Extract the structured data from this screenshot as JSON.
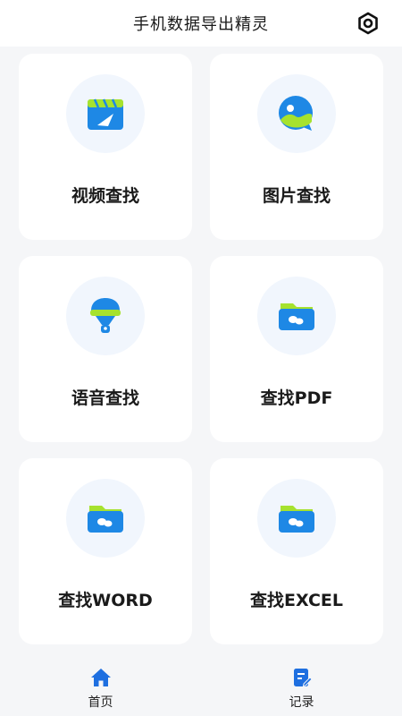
{
  "header": {
    "title": "手机数据导出精灵",
    "settings_icon": "settings-eye-icon"
  },
  "cards": [
    {
      "label": "视频查找",
      "icon": "video-icon"
    },
    {
      "label": "图片查找",
      "icon": "image-icon"
    },
    {
      "label": "语音查找",
      "icon": "voice-icon"
    },
    {
      "label": "查找PDF",
      "icon": "folder-icon"
    },
    {
      "label": "查找WORD",
      "icon": "folder-icon"
    },
    {
      "label": "查找EXCEL",
      "icon": "folder-icon"
    }
  ],
  "bottom_nav": [
    {
      "label": "首页",
      "icon": "home-icon",
      "active": true
    },
    {
      "label": "记录",
      "icon": "record-icon",
      "active": false
    }
  ],
  "colors": {
    "accent": "#2a7de1",
    "icon_blue": "#1e88e5",
    "icon_green": "#a6e22e",
    "card_bg": "#ffffff",
    "page_bg": "#f5f6f8"
  }
}
